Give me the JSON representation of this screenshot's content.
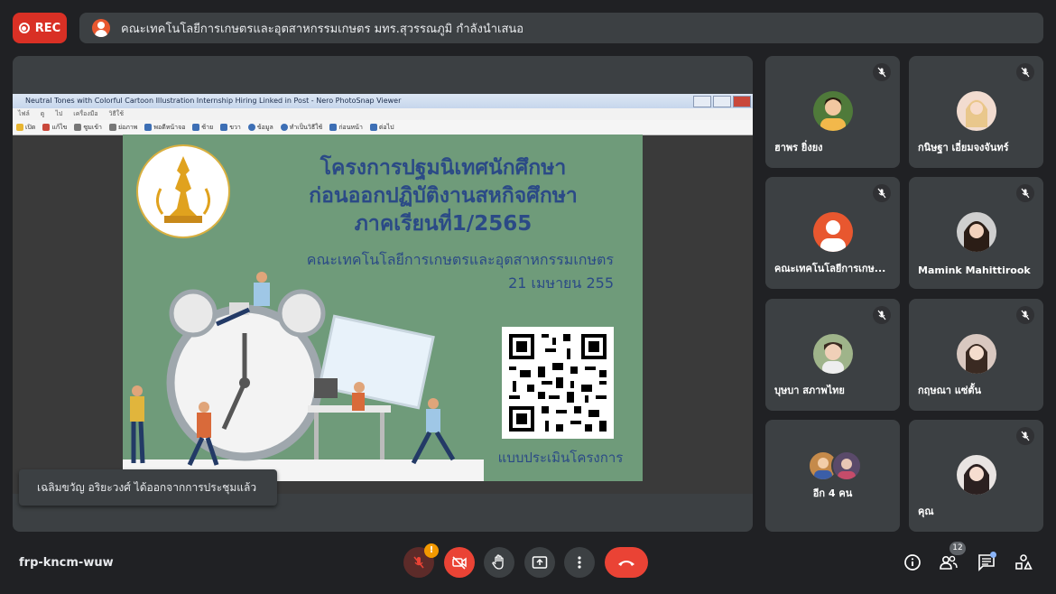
{
  "top": {
    "rec_label": "REC",
    "presenter_text": "คณะเทคโนโลยีการเกษตรและอุตสาหกรรมเกษตร มทร.สุวรรณภูมิ กำลังนำเสนอ"
  },
  "viewer": {
    "title": "Neutral Tones with Colorful Cartoon Illustration Internship Hiring Linked in Post - Nero PhotoSnap Viewer",
    "menu": [
      "ไฟล์",
      "ดู",
      "ไป",
      "เครื่องมือ",
      "วิธีใช้"
    ],
    "toolbar": [
      "เปิด",
      "แก้ไข",
      "ซูมเข้า",
      "ย่อภาพ",
      "พอดีหน้าจอ",
      "ซ้าย",
      "ขวา",
      "ข้อมูล",
      "ทำเป็นวิธีใช้",
      "ก่อนหน้า",
      "ต่อไป"
    ]
  },
  "slide": {
    "title_lines": [
      "โครงการปฐมนิเทศนักศึกษา",
      "ก่อนออกปฏิบัติงานสหกิจศึกษา",
      "ภาคเรียนที่1/2565"
    ],
    "faculty": "คณะเทคโนโลยีการเกษตรและอุตสาหกรรมเกษตร",
    "date": "21 เมษายน 255",
    "qr_caption": "แบบประเมินโครงการ",
    "colors": {
      "background": "#6f9b7a",
      "title": "#2b4a86"
    }
  },
  "toast": "เฉลิมขวัญ อริยะวงศ์ ได้ออกจากการประชุมแล้ว",
  "participants": [
    {
      "name": "ฮาพร ยิ่งยง",
      "muted": true
    },
    {
      "name": "กนิษฐา เอี่ยมจงจันทร์",
      "muted": true
    },
    {
      "name": "คณะเทคโนโลยีการเกษ...",
      "muted": true
    },
    {
      "name": "Mamink Mahittirook",
      "muted": true
    },
    {
      "name": "บุษบา สภาพไทย",
      "muted": true
    },
    {
      "name": "กฤษณา แซ่ตั้น",
      "muted": true
    },
    {
      "name": "อีก 4 คน",
      "muted": false
    },
    {
      "name": "คุณ",
      "muted": true
    }
  ],
  "bottom": {
    "meeting_code": "frp-kncm-wuw",
    "alert_badge": "!",
    "people_count": "12",
    "icons": [
      "mic-off-icon",
      "camera-off-icon",
      "raise-hand-icon",
      "present-icon",
      "more-icon",
      "hangup-icon",
      "info-icon",
      "people-icon",
      "chat-icon",
      "activities-icon"
    ]
  }
}
